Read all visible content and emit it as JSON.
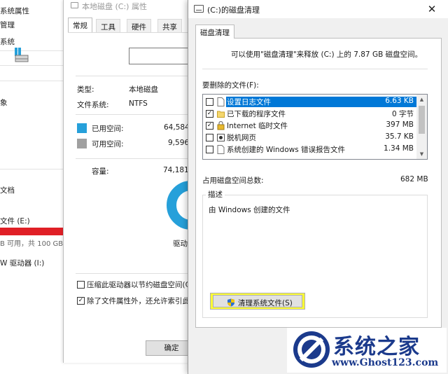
{
  "explorer": {
    "items": [
      {
        "label": "系统属性"
      },
      {
        "label": "管理"
      },
      {
        "label": "系统"
      },
      {
        "label": "象"
      },
      {
        "label": "文档"
      },
      {
        "label": "文件 (E:)"
      },
      {
        "label": "W 驱动器 (I:)"
      }
    ],
    "drive_sub": "B 可用，共 100 GB"
  },
  "properties": {
    "title": "本地磁盘 (C:) 属性",
    "tabs": [
      "常规",
      "工具",
      "硬件",
      "共享"
    ],
    "type_label": "类型:",
    "type_value": "本地磁盘",
    "fs_label": "文件系统:",
    "fs_value": "NTFS",
    "used_label": "已用空间:",
    "used_value": "64,584,",
    "free_label": "可用空间:",
    "free_value": "9,596,",
    "capacity_label": "容量:",
    "capacity_value": "74,181,",
    "drive_label": "驱动",
    "compress_label": "压缩此驱动器以节约磁盘空间(C",
    "compress_checked": false,
    "index_label": "除了文件属性外，还允许索引此",
    "index_checked": true,
    "ok_label": "确定",
    "colors": {
      "used": "#26a0da",
      "free": "#a0a0a0"
    }
  },
  "cleanup": {
    "title": "(C:)的磁盘清理",
    "close_glyph": "✕",
    "tab": "磁盘清理",
    "summary": "可以使用\"磁盘清理\"来释放 (C:) 上的 7.87 GB 磁盘空间。",
    "list_label": "要删除的文件(F):",
    "items": [
      {
        "name": "设置日志文件",
        "size": "6.63 KB",
        "checked": false,
        "selected": true,
        "icon": "file-icon"
      },
      {
        "name": "已下载的程序文件",
        "size": "0 字节",
        "checked": true,
        "selected": false,
        "icon": "folder-icon"
      },
      {
        "name": "Internet 临时文件",
        "size": "397 MB",
        "checked": true,
        "selected": false,
        "icon": "lock-icon"
      },
      {
        "name": "脱机网页",
        "size": "35.7 KB",
        "checked": false,
        "selected": false,
        "icon": "webpage-icon"
      },
      {
        "name": "系统创建的 Windows 错误报告文件",
        "size": "1.34 MB",
        "checked": false,
        "selected": false,
        "icon": "file-icon"
      }
    ],
    "total_label": "占用磁盘空间总数:",
    "total_value": "682 MB",
    "desc_legend": "描述",
    "desc_text": "由 Windows 创建的文件",
    "cleanup_system_label": "清理系统文件(S)",
    "accent": "#0078d7",
    "highlight": "#ffff33"
  },
  "watermark": {
    "title": "系统之家",
    "url": "www.Ghost123.com",
    "color": "#1b3a8c"
  }
}
